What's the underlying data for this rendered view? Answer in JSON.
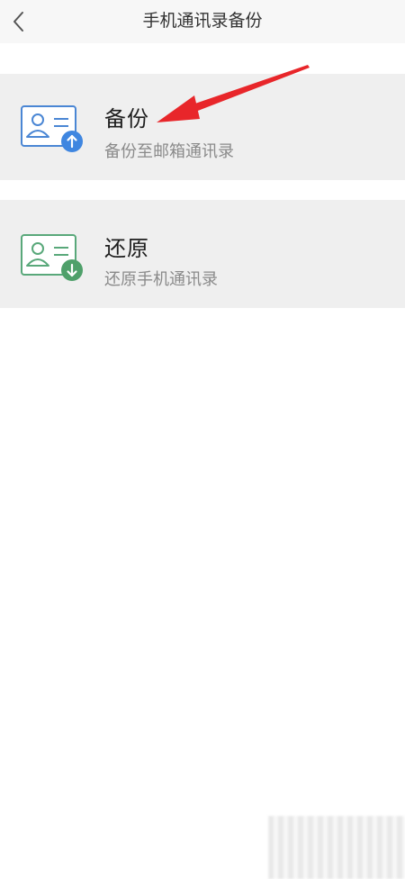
{
  "header": {
    "title": "手机通讯录备份",
    "back_icon": "chevron-left-icon"
  },
  "cards": [
    {
      "title": "备份",
      "subtitle": "备份至邮箱通讯录",
      "icon": "contact-card-upload-icon",
      "icon_color": "#4a86d4",
      "badge_color": "#3f86e0"
    },
    {
      "title": "还原",
      "subtitle": "还原手机通讯录",
      "icon": "contact-card-download-icon",
      "icon_color": "#59a87a",
      "badge_color": "#4fa06a"
    }
  ],
  "annotation": {
    "icon": "red-arrow-icon",
    "color": "#e8262a"
  },
  "colors": {
    "header_bg": "#f7f7f7",
    "card_bg": "#efefef",
    "page_bg": "#ffffff"
  }
}
